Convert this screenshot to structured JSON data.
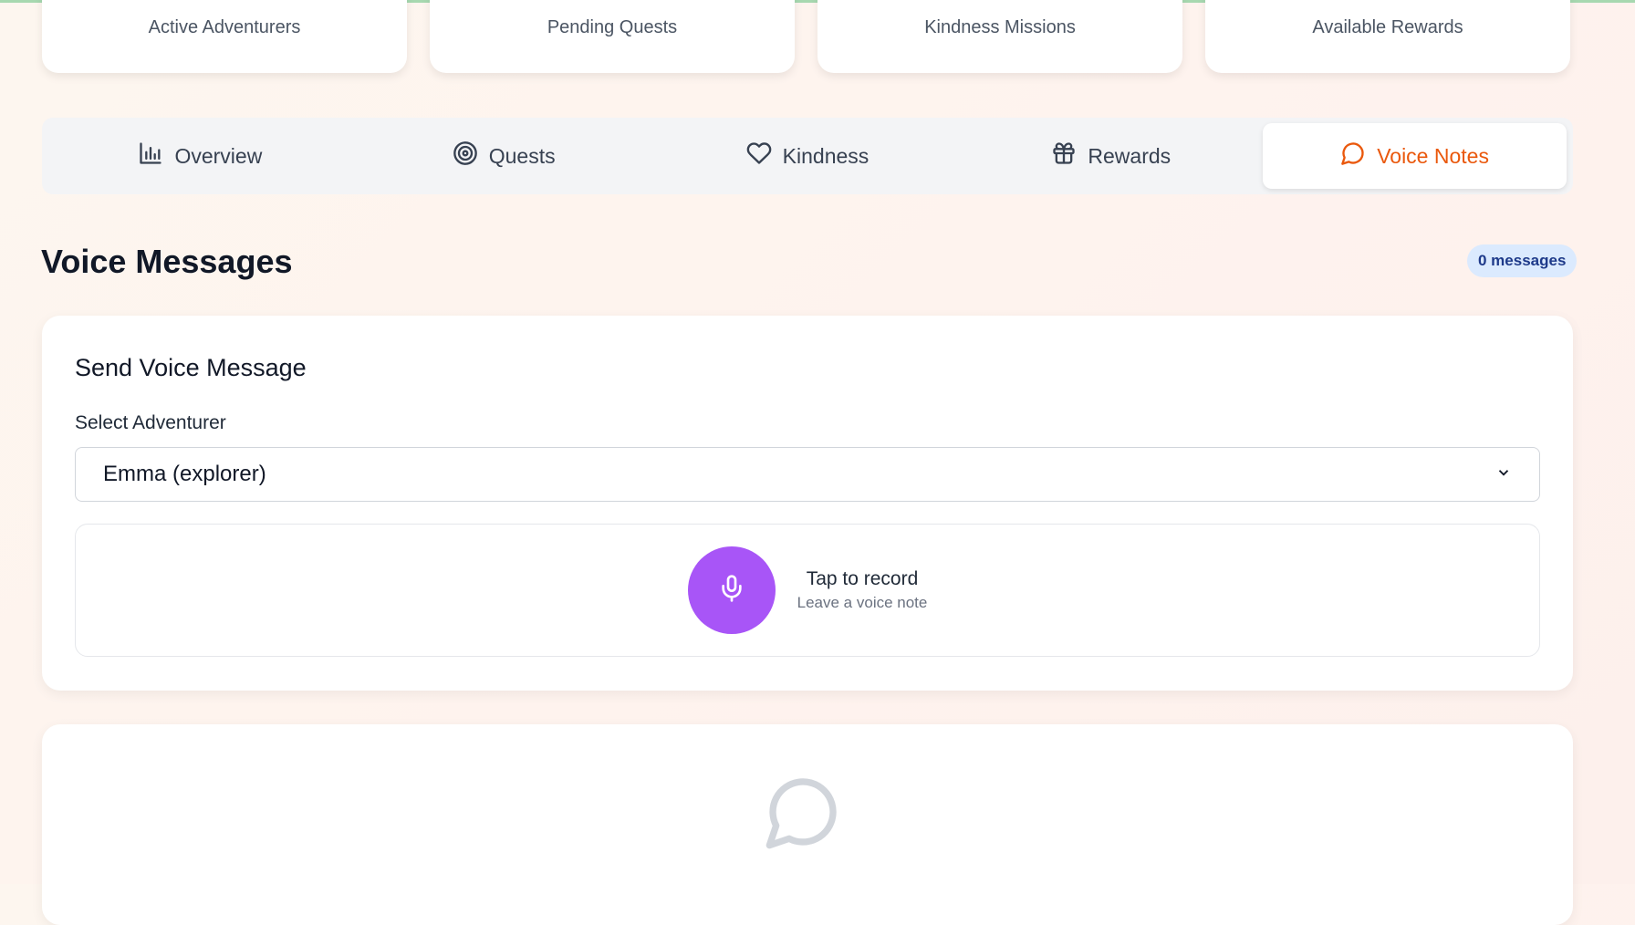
{
  "stats": [
    {
      "label": "Active Adventurers"
    },
    {
      "label": "Pending Quests"
    },
    {
      "label": "Kindness Missions"
    },
    {
      "label": "Available Rewards"
    }
  ],
  "tabs": [
    {
      "label": "Overview",
      "icon": "bar-chart-icon"
    },
    {
      "label": "Quests",
      "icon": "target-icon"
    },
    {
      "label": "Kindness",
      "icon": "heart-icon"
    },
    {
      "label": "Rewards",
      "icon": "gift-icon"
    },
    {
      "label": "Voice Notes",
      "icon": "message-circle-icon",
      "active": true
    }
  ],
  "section": {
    "title": "Voice Messages",
    "badge": "0 messages"
  },
  "send": {
    "title": "Send Voice Message",
    "select_label": "Select Adventurer",
    "selected_adventurer": "Emma (explorer)",
    "record_title": "Tap to record",
    "record_subtitle": "Leave a voice note"
  },
  "colors": {
    "accent": "#ea580c",
    "record_button": "#a855f7",
    "badge_bg": "#dbeafe",
    "badge_text": "#1e3a8a"
  }
}
